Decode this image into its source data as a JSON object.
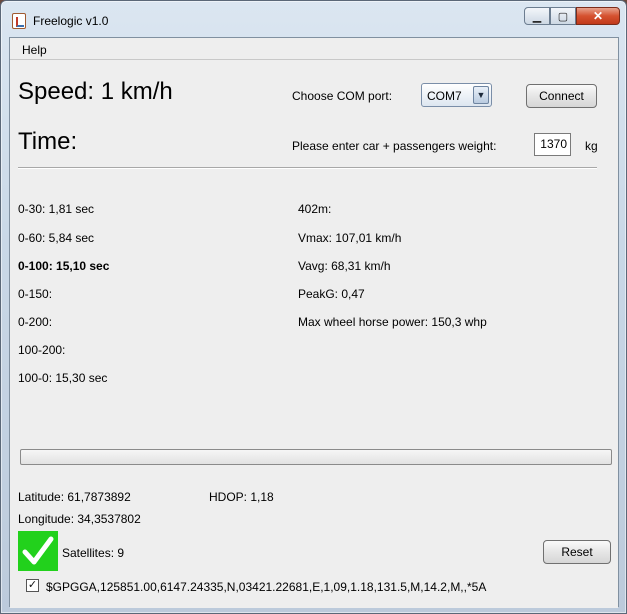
{
  "window": {
    "title": "Freelogic v1.0",
    "controls": {
      "minimize": "▁",
      "maximize": "▢",
      "close": "✕"
    }
  },
  "menu": {
    "items": [
      "Help"
    ]
  },
  "speed": {
    "text": "Speed: 1 km/h"
  },
  "time": {
    "text": "Time:"
  },
  "com": {
    "label": "Choose COM port:",
    "selected": "COM7",
    "arrow": "▼",
    "connect_label": "Connect"
  },
  "weight": {
    "label": "Please enter car + passengers weight:",
    "value": "1370",
    "unit": "kg"
  },
  "results_left": [
    {
      "text": "0-30: 1,81 sec",
      "bold": false
    },
    {
      "text": "0-60: 5,84 sec",
      "bold": false
    },
    {
      "text": "0-100: 15,10 sec",
      "bold": true
    },
    {
      "text": "0-150:",
      "bold": false
    },
    {
      "text": "0-200:",
      "bold": false
    },
    {
      "text": "100-200:",
      "bold": false
    },
    {
      "text": "100-0: 15,30 sec",
      "bold": false
    }
  ],
  "results_right": [
    {
      "text": "402m:"
    },
    {
      "text": "Vmax: 107,01 km/h"
    },
    {
      "text": "Vavg: 68,31 km/h"
    },
    {
      "text": "PeakG: 0,47"
    },
    {
      "text": "Max wheel horse power: 150,3 whp"
    }
  ],
  "progress": {
    "fraction": 0
  },
  "gps": {
    "latitude": "Latitude: 61,7873892",
    "hdop": "HDOP: 1,18",
    "longitude": "Longitude: 34,3537802",
    "satellites": "Satellites: 9",
    "fix_color": "#22d11c",
    "fix_icon": "checkmark-icon",
    "nmea_checked": true,
    "nmea_check_glyph": "✓",
    "nmea": "$GPGGA,125851.00,6147.24335,N,03421.22681,E,1,09,1.18,131.5,M,14.2,M,,*5A"
  },
  "reset_label": "Reset"
}
